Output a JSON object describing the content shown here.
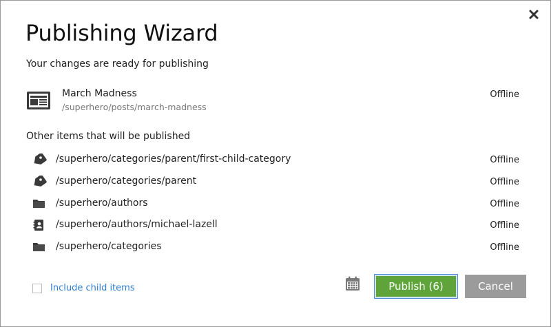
{
  "dialog": {
    "title": "Publishing Wizard",
    "subtitle": "Your changes are ready for publishing",
    "main_item": {
      "name": "March Madness",
      "path": "/superhero/posts/march-madness",
      "status": "Offline",
      "icon": "newspaper-icon"
    },
    "other_items_label": "Other items that will be published",
    "other_items": [
      {
        "path": "/superhero/categories/parent/first-child-category",
        "status": "Offline",
        "icon": "tag-icon"
      },
      {
        "path": "/superhero/categories/parent",
        "status": "Offline",
        "icon": "tag-icon"
      },
      {
        "path": "/superhero/authors",
        "status": "Offline",
        "icon": "folder-icon"
      },
      {
        "path": "/superhero/authors/michael-lazell",
        "status": "Offline",
        "icon": "contact-book-icon"
      },
      {
        "path": "/superhero/categories",
        "status": "Offline",
        "icon": "folder-icon"
      }
    ],
    "include_child_items_label": "Include child items",
    "publish_label": "Publish (6)",
    "cancel_label": "Cancel"
  },
  "colors": {
    "publish_button": "#5ea43a",
    "cancel_button": "#9b9b9b",
    "link": "#2d7dd2",
    "icon": "#3a3a3a"
  }
}
